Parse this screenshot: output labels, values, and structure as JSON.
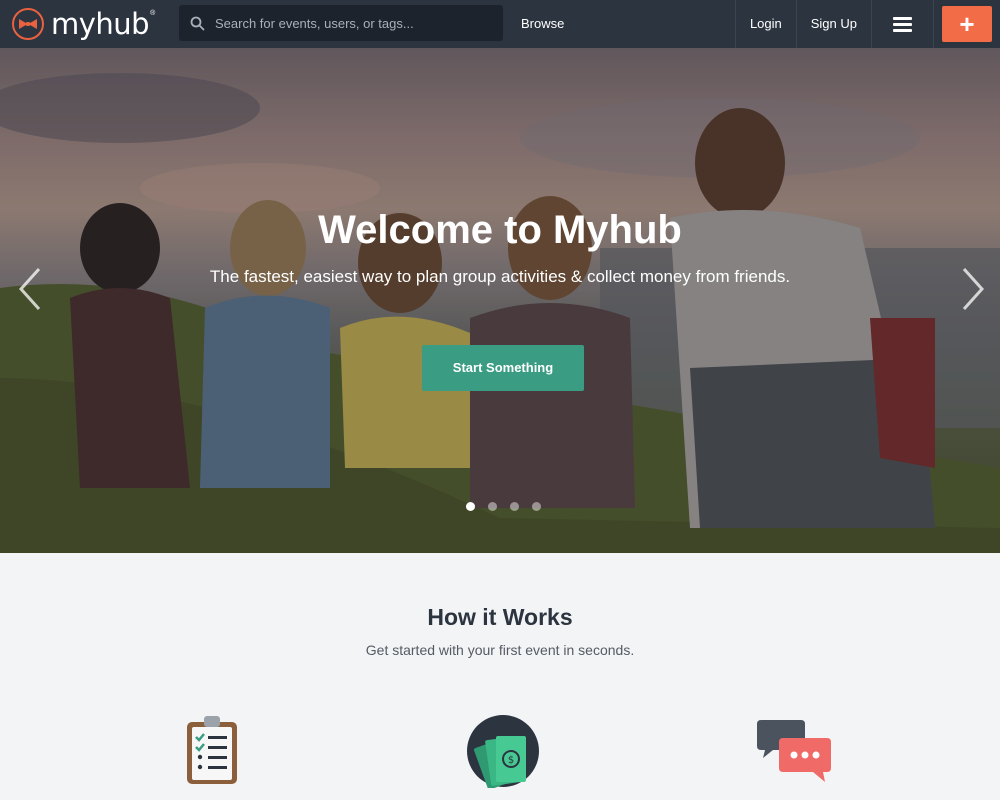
{
  "nav": {
    "brand": "myhub",
    "brand_mark": "®",
    "search_placeholder": "Search for events, users, or tags...",
    "browse_label": "Browse",
    "login_label": "Login",
    "signup_label": "Sign Up",
    "create_label": "+"
  },
  "hero": {
    "title": "Welcome to Myhub",
    "subtitle": "The fastest, easiest way to plan group activities & collect money from friends.",
    "cta_label": "Start Something",
    "slides": 4,
    "active_slide": 1
  },
  "how": {
    "title": "How it Works",
    "subtitle": "Get started with your first event in seconds.",
    "features": [
      {
        "icon": "clipboard-checklist-icon"
      },
      {
        "icon": "money-bills-icon"
      },
      {
        "icon": "chat-bubbles-icon"
      }
    ]
  },
  "colors": {
    "nav_bg": "#2c3440",
    "brand_accent": "#f26c47",
    "cta_green": "#3a9c83",
    "page_bg": "#f3f4f6"
  }
}
